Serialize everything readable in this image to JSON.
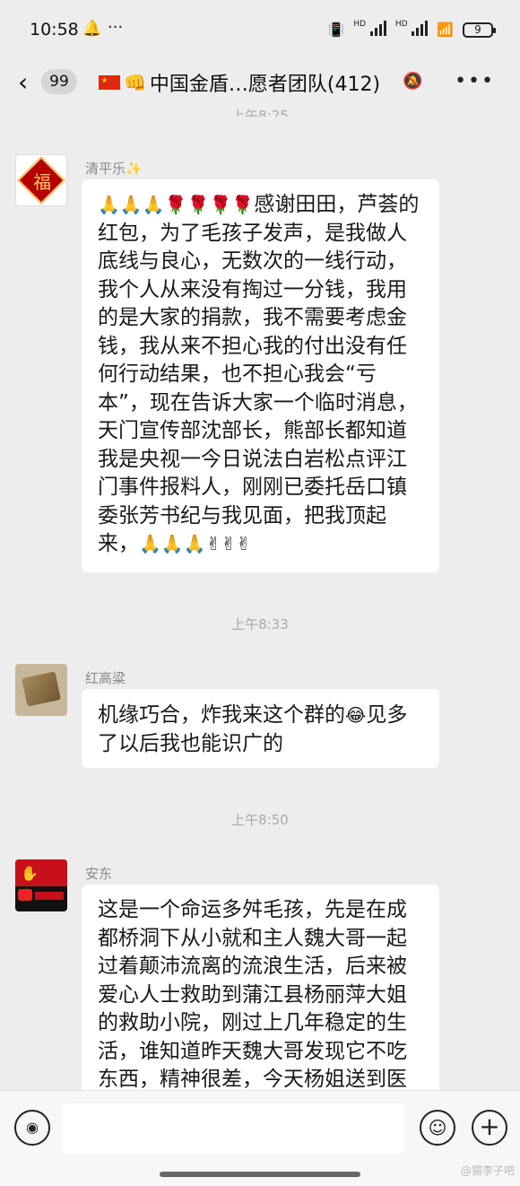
{
  "status_bar": {
    "time": "10:58",
    "more": "···",
    "network_left": "HD",
    "network_right": "HD",
    "battery": "9"
  },
  "nav": {
    "unread_count": "99",
    "title": "中国金盾…愿者团队(412)"
  },
  "chat": {
    "partial_timestamp": "上午8:25",
    "messages": [
      {
        "sender": "清平乐✨",
        "avatar": "fu-character-avatar",
        "emoji_prefix": "🙏🙏🙏🌹🌹🌹🌹",
        "text": "感谢田田，芦荟的红包，为了毛孩子发声，是我做人底线与良心，无数次的一线行动，我个人从来没有掏过一分钱，我用的是大家的捐款，我不需要考虑金钱，我从来不担心我的付出没有任何行动结果，也不担心我会“亏本”，现在告诉大家一个临时消息，天门宣传部沈部长，熊部长都知道我是央视一今日说法白岩松点评江门事件报料人，刚刚已委托岳口镇委张芳书纪与我见面，把我顶起来，",
        "emoji_suffix": "🙏🙏🙏✌✌✌"
      },
      {
        "timestamp": "上午8:33",
        "sender": "红高粱",
        "avatar": "book-photo-avatar",
        "text_before": "机缘巧合，炸我来这个群的",
        "emoji_mid": "😂",
        "text_after": "见多了以后我也能识广的"
      },
      {
        "timestamp": "上午8:50",
        "sender": "安东",
        "avatar": "red-poster-avatar",
        "text": "这是一个命运多舛毛孩，先是在成都桥洞下从小就和主人魏大哥一起过着颠沛流离的流浪生活，后来被爱心人士救助到蒲江县杨丽萍大姐的救助小院，刚过上几年稳定的生活，谁知道昨天魏大哥发现它不吃东西，精神很差，今天杨姐送到医"
      }
    ]
  },
  "input_bar": {
    "placeholder": ""
  },
  "watermark": "@猫李子吧",
  "colors": {
    "background": "#ededed",
    "bubble": "#ffffff",
    "timestamp": "#a9a9a9",
    "sender": "#8a8a8a"
  }
}
